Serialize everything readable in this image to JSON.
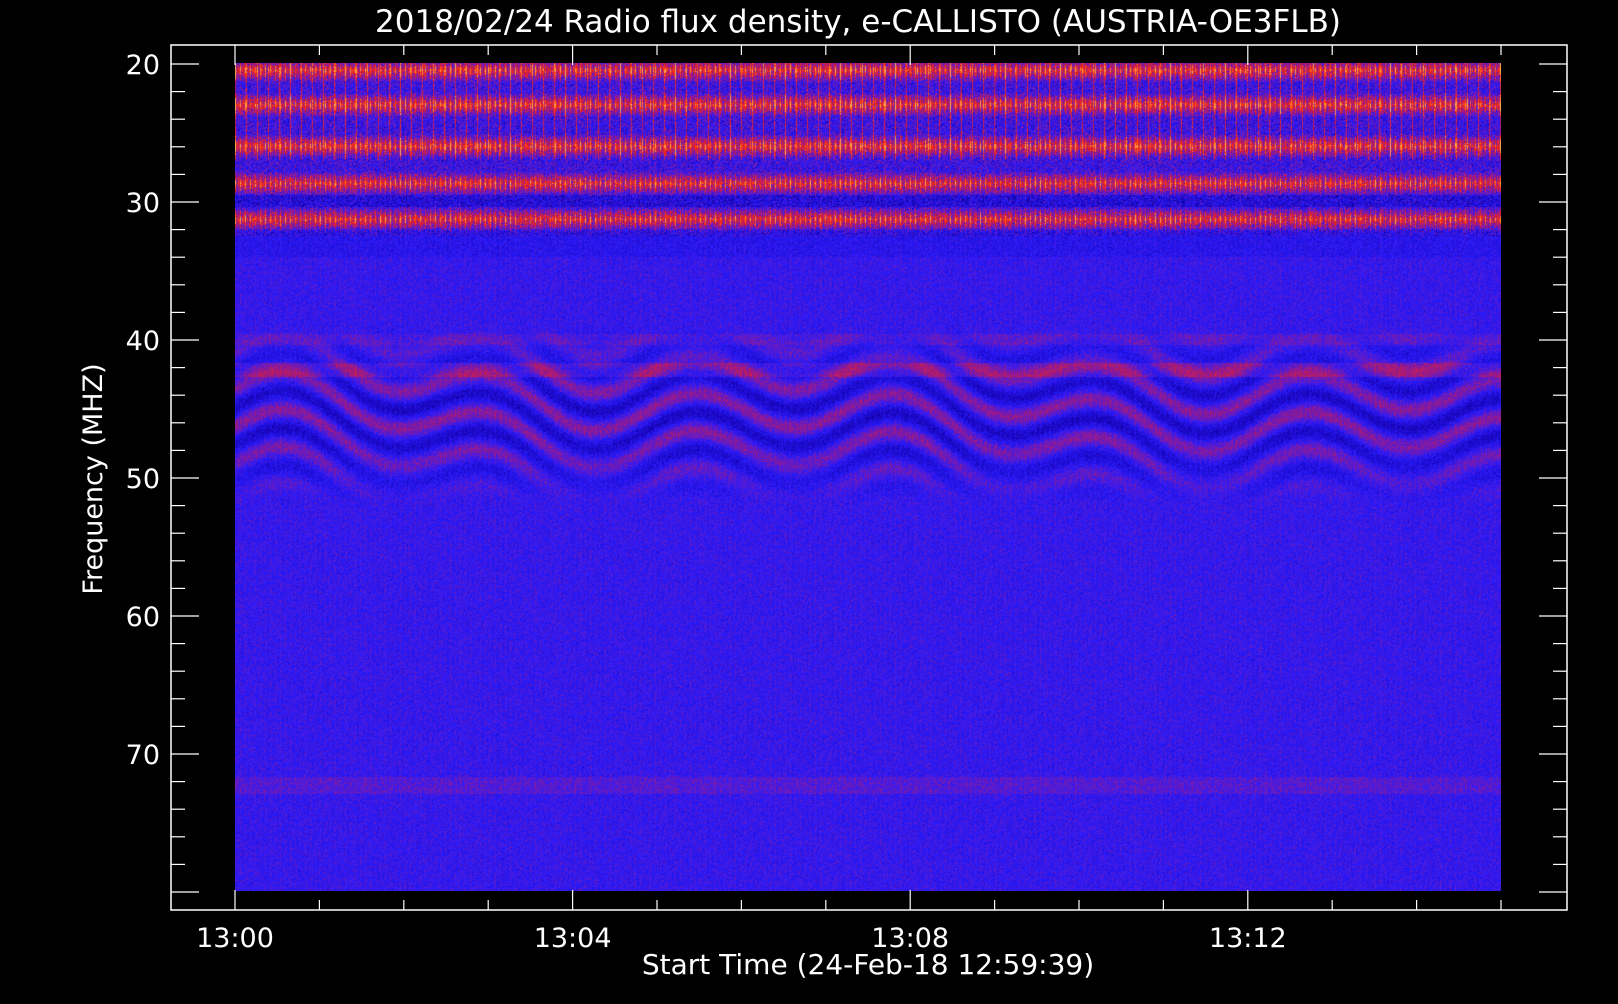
{
  "chart_data": {
    "type": "heatmap",
    "title": "2018/02/24  Radio flux density, e-CALLISTO (AUSTRIA-OE3FLB)",
    "xlabel": "Start Time (24-Feb-18 12:59:39)",
    "ylabel": "Frequency (MHZ)",
    "x_ticks": [
      "13:00",
      "13:04",
      "13:08",
      "13:12"
    ],
    "x_tick_minutes": [
      0,
      4,
      8,
      12
    ],
    "x_range_minutes": [
      0,
      15
    ],
    "y_ticks": [
      20,
      30,
      40,
      50,
      60,
      70
    ],
    "y_range": [
      20,
      80
    ],
    "y_inverted": true,
    "grid": false,
    "colormap": [
      "#000000",
      "#1a00b0",
      "#2a1cff",
      "#b01a7a",
      "#ff2a00",
      "#ffb050"
    ],
    "background": "#000000",
    "foreground": "#ffffff",
    "features": [
      {
        "label": "",
        "freq_mhz": [
          20,
          32
        ],
        "intensity": "high"
      },
      {
        "label": "",
        "freq_mhz": [
          40,
          51
        ],
        "intensity": "medium"
      },
      {
        "label": "",
        "freq_mhz": [
          72,
          73
        ],
        "intensity": "low"
      }
    ]
  }
}
